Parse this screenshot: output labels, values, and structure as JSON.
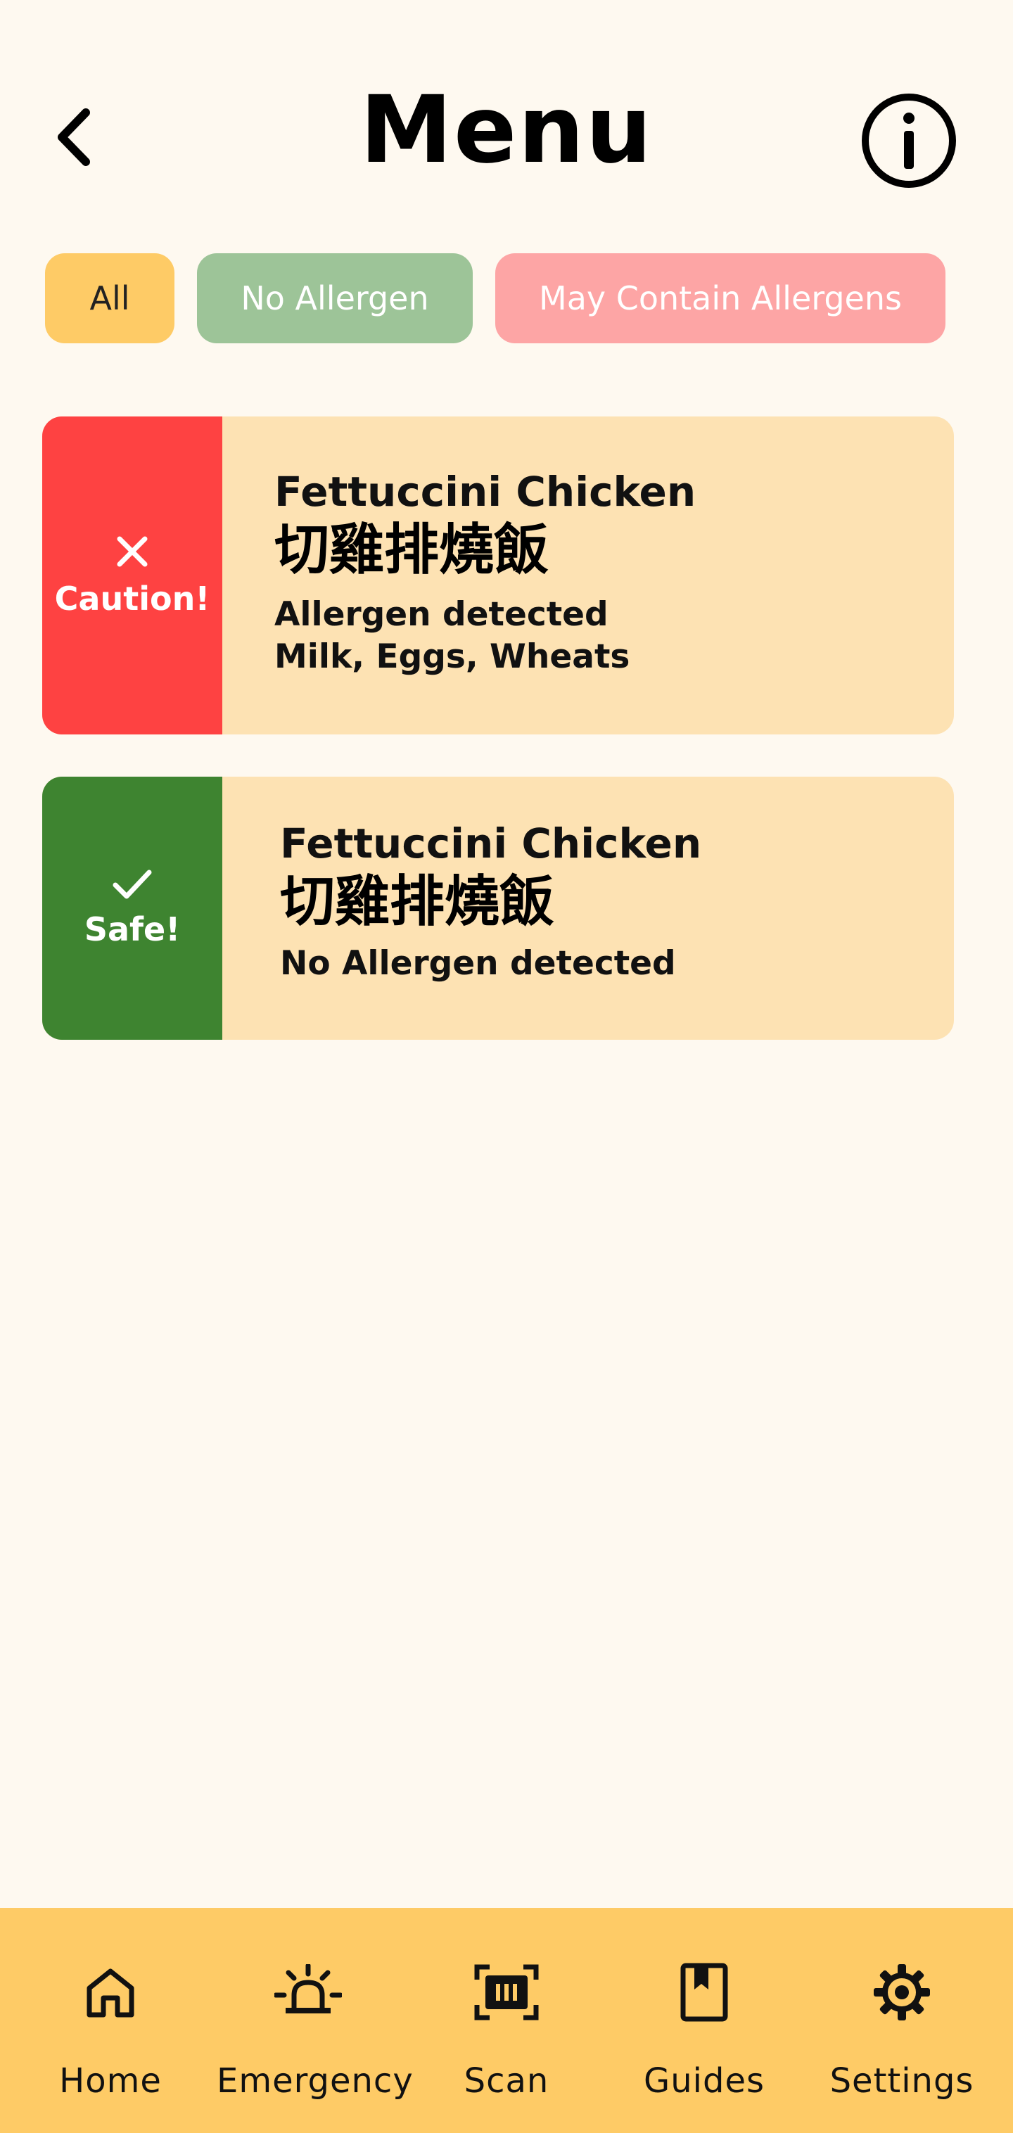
{
  "header": {
    "title": "Menu"
  },
  "filters": {
    "all": "All",
    "no_allergen": "No Allergen",
    "may_contain": "May Contain Allergens"
  },
  "items": [
    {
      "status": "Caution!",
      "name": "Fettuccini Chicken",
      "name_cn": "切雞排燒飯",
      "line1": "Allergen detected",
      "line2": "Milk, Eggs, Wheats"
    },
    {
      "status": "Safe!",
      "name": "Fettuccini Chicken",
      "name_cn": "切雞排燒飯",
      "line1": "No Allergen detected"
    }
  ],
  "nav": {
    "home": "Home",
    "emergency": "Emergency",
    "scan": "Scan",
    "guides": "Guides",
    "settings": "Settings"
  },
  "colors": {
    "background": "#FEF9F0",
    "accent": "#FECB66",
    "safe_chip": "#9DC498",
    "allergen_chip": "#FDA5A5",
    "caution": "#FE4242",
    "safe": "#3E8430",
    "card": "#FDE2B3"
  }
}
